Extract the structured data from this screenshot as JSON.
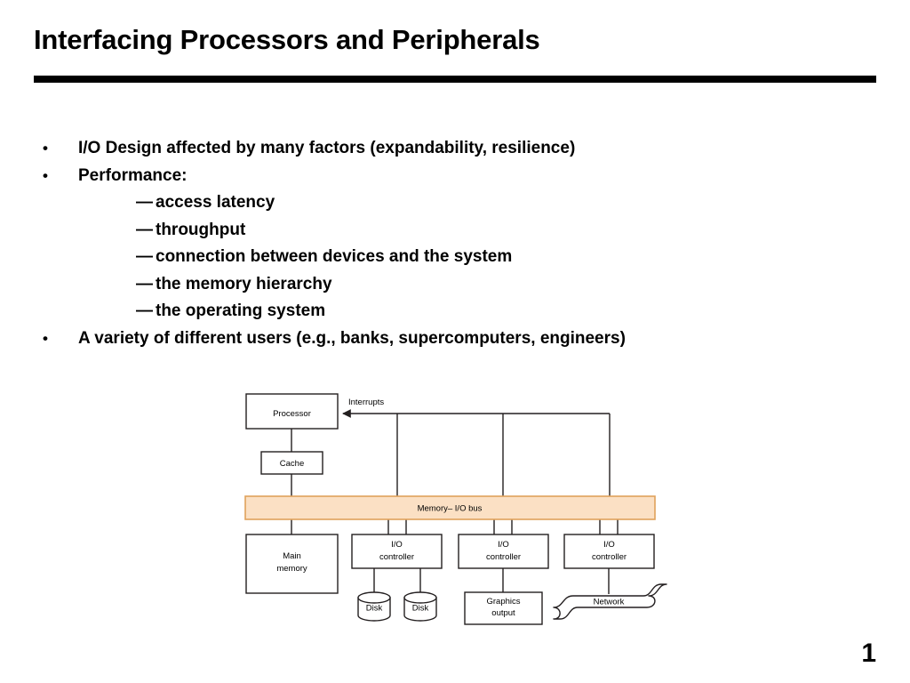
{
  "slide": {
    "title": "Interfacing Processors and Peripherals",
    "page_number": "1"
  },
  "body": {
    "bullet_marker": "•",
    "dash_marker": "—",
    "items": [
      {
        "type": "bullet",
        "text": "I/O Design affected by many factors (expandability, resilience)"
      },
      {
        "type": "bullet",
        "text": "Performance:"
      },
      {
        "type": "sub",
        "text": "access latency"
      },
      {
        "type": "sub",
        "text": "throughput"
      },
      {
        "type": "sub",
        "text": "connection between devices and the system"
      },
      {
        "type": "sub",
        "text": "the memory hierarchy"
      },
      {
        "type": "sub",
        "text": "the operating system"
      },
      {
        "type": "bullet",
        "text": "A variety of different users (e.g., banks, supercomputers, engineers)"
      }
    ]
  },
  "diagram": {
    "colors": {
      "bus_fill": "#fbe0c4",
      "bus_stroke": "#e0a15c",
      "line": "#231f20",
      "box_fill": "#ffffff"
    },
    "labels": {
      "processor": "Processor",
      "cache": "Cache",
      "interrupts": "Interrupts",
      "bus": "Memory– I/O bus",
      "main_memory_line1": "Main",
      "main_memory_line2": "memory",
      "io_controller_line1": "I/O",
      "io_controller_line2": "controller",
      "disk_1": "Disk",
      "disk_2": "Disk",
      "graphics_line1": "Graphics",
      "graphics_line2": "output",
      "network": "Network"
    }
  }
}
